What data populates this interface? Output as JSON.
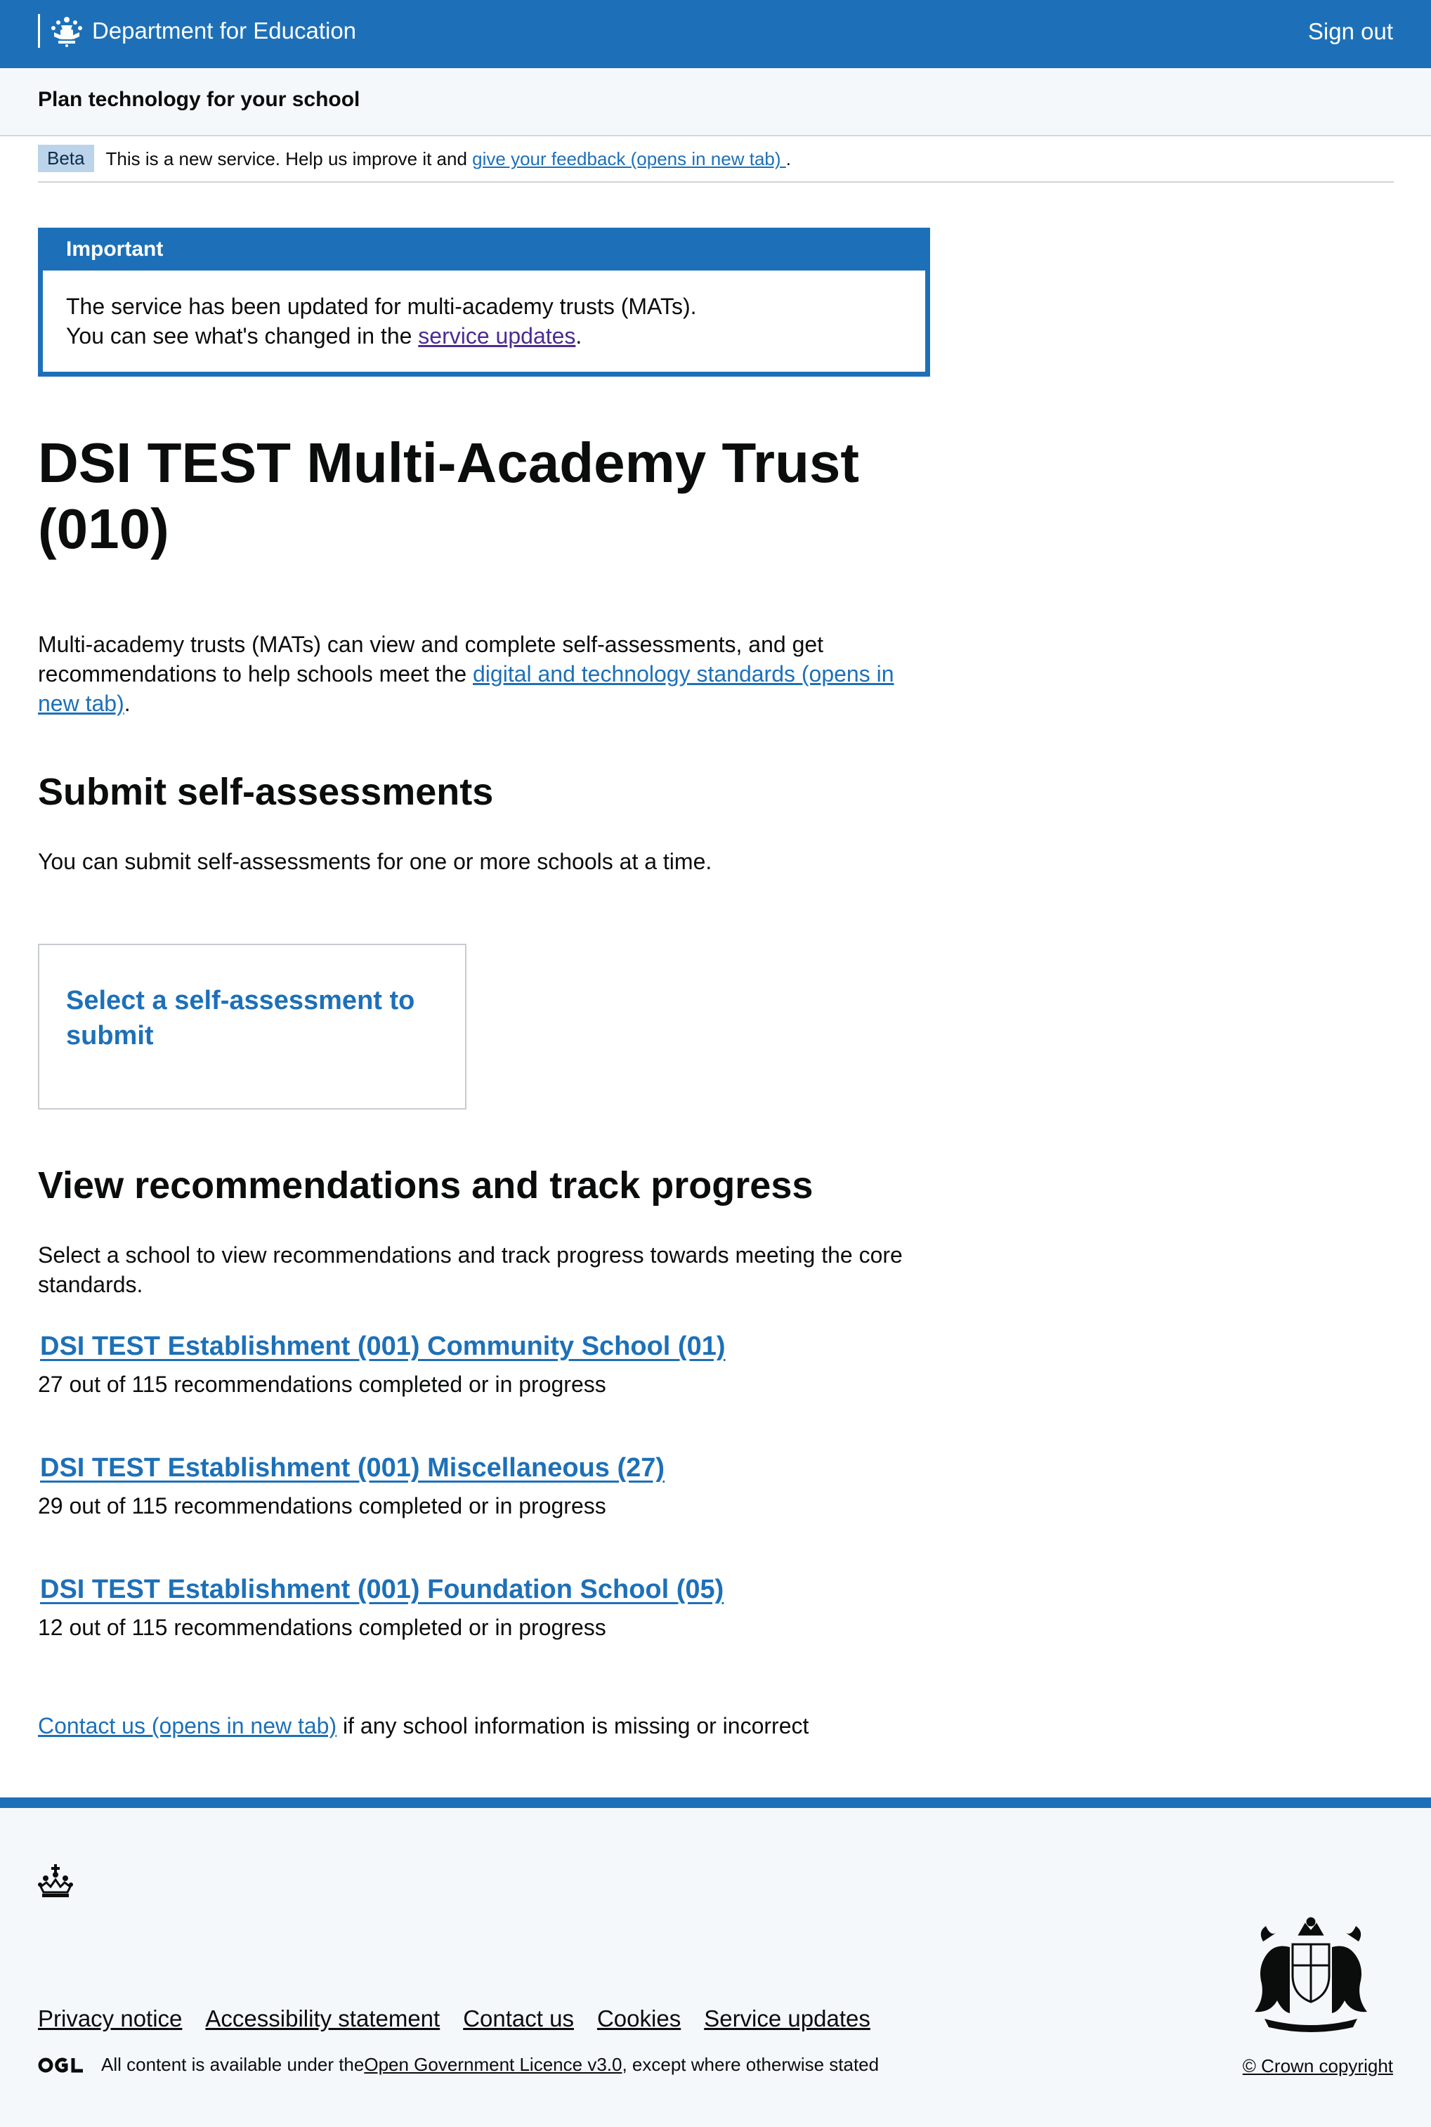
{
  "header": {
    "brand": "Department for Education",
    "sign_out": "Sign out",
    "brand_color": "#1d70b8"
  },
  "service": {
    "name": "Plan technology for your school"
  },
  "phase_banner": {
    "tag": "Beta",
    "text": "This is a new service. Help us improve it and ",
    "link": "give your feedback (opens in new tab) ",
    "after": "."
  },
  "important": {
    "title": "Important",
    "line1": "The service has been updated for multi-academy trusts (MATs).",
    "line2_before": "You can see what's changed in the ",
    "line2_link": "service updates",
    "line2_after": "."
  },
  "main": {
    "title": "DSI TEST Multi-Academy Trust (010)",
    "lead_before": "Multi-academy trusts (MATs) can view and complete self-assessments, and get recommendations to help schools meet the ",
    "lead_link": "digital and technology standards (opens in new tab)",
    "lead_after": ".",
    "submit_heading": "Submit self-assessments",
    "submit_text": "You can submit self-assessments for one or more schools at a time.",
    "card_link": "Select a self-assessment to submit",
    "view_heading": "View recommendations and track progress",
    "view_text": "Select a school to view recommendations and track progress towards meeting the core standards.",
    "schools": [
      {
        "name": "DSI TEST Establishment (001) Community School (01)",
        "progress": "27 out of 115 recommendations completed or in progress"
      },
      {
        "name": "DSI TEST Establishment (001) Miscellaneous (27)",
        "progress": "29 out of 115 recommendations completed or in progress"
      },
      {
        "name": "DSI TEST Establishment (001) Foundation School (05)",
        "progress": "12 out of 115 recommendations completed or in progress"
      }
    ],
    "contact_link": "Contact us (opens in new tab)",
    "contact_after": " if any school information is missing or incorrect"
  },
  "footer": {
    "links": [
      "Privacy notice",
      "Accessibility statement",
      "Contact us",
      "Cookies",
      "Service updates"
    ],
    "licence_before": "All content is available under the ",
    "licence_link": "Open Government Licence v3.0",
    "licence_after": ", except where otherwise stated",
    "copyright": "© Crown copyright"
  }
}
